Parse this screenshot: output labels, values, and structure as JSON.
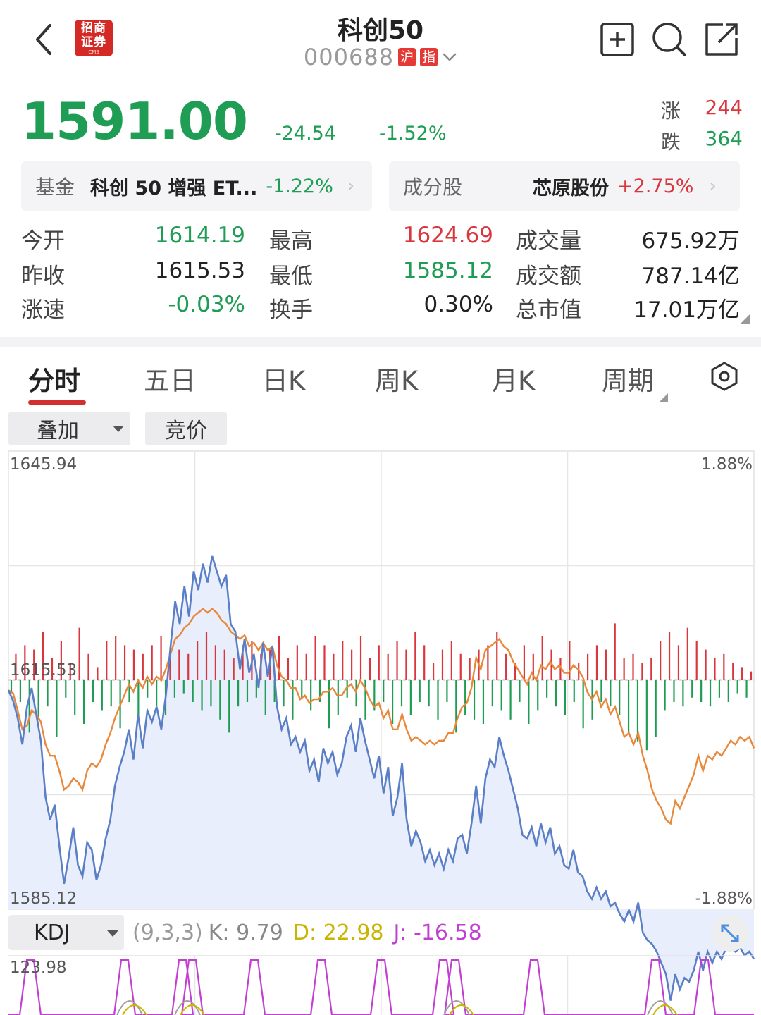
{
  "header": {
    "title": "科创50",
    "code": "000688",
    "tag_market": "沪",
    "tag_type": "指",
    "logo_line1": "招商",
    "logo_line2": "证券",
    "logo_line3": "CMS"
  },
  "quote": {
    "price": "1591.00",
    "change": "-24.54",
    "change_pct": "-1.52%",
    "up_label": "涨",
    "up_count": "244",
    "down_label": "跌",
    "down_count": "364"
  },
  "fund_card": {
    "label": "基金",
    "name": "科创 50 增强 ET...",
    "change": "-1.22%"
  },
  "component_card": {
    "label": "成分股",
    "name": "芯原股份",
    "change": "+2.75%"
  },
  "stats": {
    "rows": [
      [
        {
          "label": "今开",
          "value": "1614.19"
        },
        {
          "label": "最高",
          "value": "1624.69"
        },
        {
          "label": "成交量",
          "value": "675.92万"
        }
      ],
      [
        {
          "label": "昨收",
          "value": "1615.53"
        },
        {
          "label": "最低",
          "value": "1585.12"
        },
        {
          "label": "成交额",
          "value": "787.14亿"
        }
      ],
      [
        {
          "label": "涨速",
          "value": "-0.03%"
        },
        {
          "label": "换手",
          "value": "0.30%"
        },
        {
          "label": "总市值",
          "value": "17.01万亿"
        }
      ]
    ]
  },
  "tabs": [
    "分时",
    "五日",
    "日K",
    "周K",
    "月K",
    "周期"
  ],
  "toolbar": {
    "overlay_label": "叠加",
    "auction_label": "竞价"
  },
  "indicator": {
    "name": "KDJ",
    "params": "(9,3,3)",
    "k_text": "K: 9.79",
    "d_text": "D: 22.98",
    "j_text": "J: -16.58",
    "axis_top": "123.98"
  },
  "colors": {
    "up": "#d9363e",
    "down": "#1f9d55",
    "price_line": "#5b7fc6",
    "avg_line": "#e8883a",
    "fill": "#e8eefb",
    "k_color": "#a0a0a0",
    "d_color": "#c9b400",
    "j_color": "#c23fd2"
  },
  "chart_data": {
    "type": "line",
    "y_labels": {
      "top": "1645.94",
      "mid": "1615.53",
      "bottom": "1585.12",
      "pct_top": "1.88%",
      "pct_bottom": "-1.88%"
    },
    "ylim": [
      1585.12,
      1645.94
    ],
    "baseline": 1615.53,
    "series": [
      {
        "values": [
          1614.2,
          1612.8,
          1610.5,
          1607.0,
          1612.0,
          1614.5,
          1611.0,
          1607.5,
          1600.0,
          1597.0,
          1599.0,
          1593.5,
          1588.5,
          1592.0,
          1596.0,
          1591.0,
          1589.5,
          1594.0,
          1593.0,
          1589.0,
          1591.0,
          1594.5,
          1597.0,
          1601.5,
          1604.0,
          1606.0,
          1609.0,
          1605.0,
          1611.0,
          1606.5,
          1611.5,
          1610.0,
          1612.0,
          1609.0,
          1613.5,
          1620.0,
          1626.0,
          1623.0,
          1628.0,
          1624.0,
          1630.0,
          1627.5,
          1631.0,
          1628.5,
          1632.0,
          1630.0,
          1628.0,
          1629.5,
          1623.0,
          1622.0,
          1617.0,
          1621.0,
          1616.5,
          1619.0,
          1614.5,
          1620.5,
          1616.0,
          1620.0,
          1612.0,
          1609.0,
          1610.5,
          1607.0,
          1608.0,
          1606.0,
          1607.5,
          1603.5,
          1605.0,
          1602.0,
          1606.5,
          1604.5,
          1606.0,
          1603.0,
          1604.5,
          1608.0,
          1609.5,
          1606.0,
          1610.5,
          1607.5,
          1605.0,
          1602.5,
          1605.5,
          1600.5,
          1604.0,
          1597.5,
          1600.0,
          1604.5,
          1597.0,
          1593.5,
          1595.5,
          1594.0,
          1591.5,
          1593.0,
          1591.0,
          1592.5,
          1590.5,
          1593.0,
          1591.5,
          1594.5,
          1595.0,
          1592.5,
          1596.5,
          1601.5,
          1596.5,
          1602.5,
          1605.0,
          1604.0,
          1608.0,
          1605.5,
          1603.5,
          1601.0,
          1598.5,
          1595.0,
          1594.5,
          1596.0,
          1593.5,
          1596.5,
          1594.0,
          1596.0,
          1592.5,
          1593.5,
          1591.0,
          1590.5,
          1593.0,
          1590.0,
          1589.5,
          1587.5,
          1586.5,
          1588.0,
          1586.5,
          1587.5,
          1585.5,
          1586.0,
          1584.5,
          1583.5,
          1585.0,
          1583.5,
          1586.0,
          1582.0,
          1581.0,
          1580.5,
          1579.5,
          1578.0,
          1576.5,
          1573.0,
          1576.5,
          1574.5,
          1576.0,
          1575.5,
          1577.0,
          1579.5,
          1577.0,
          1579.5,
          1578.0,
          1579.5,
          1578.5,
          1580.0,
          1580.5,
          1579.5,
          1580.0,
          1579.0,
          1579.5,
          1578.5
        ]
      },
      {
        "values": [
          1614.2,
          1613.8,
          1611.5,
          1609.0,
          1609.5,
          1611.5,
          1611.0,
          1610.0,
          1607.0,
          1605.5,
          1605.5,
          1603.5,
          1601.0,
          1601.5,
          1602.5,
          1602.0,
          1601.0,
          1603.5,
          1604.5,
          1604.0,
          1605.0,
          1607.0,
          1608.5,
          1610.5,
          1612.0,
          1613.5,
          1615.0,
          1614.0,
          1615.5,
          1614.5,
          1616.0,
          1615.0,
          1616.0,
          1615.5,
          1617.0,
          1619.0,
          1621.0,
          1621.5,
          1622.5,
          1623.0,
          1624.0,
          1624.5,
          1625.0,
          1624.5,
          1625.0,
          1624.5,
          1623.5,
          1623.0,
          1622.0,
          1621.5,
          1621.0,
          1621.5,
          1620.0,
          1620.5,
          1619.5,
          1620.5,
          1619.5,
          1620.0,
          1617.5,
          1616.0,
          1615.5,
          1614.5,
          1614.5,
          1613.0,
          1613.5,
          1612.5,
          1613.0,
          1613.0,
          1614.0,
          1614.0,
          1614.5,
          1613.5,
          1613.5,
          1614.5,
          1615.0,
          1614.0,
          1615.5,
          1614.5,
          1613.0,
          1612.0,
          1612.5,
          1610.5,
          1611.5,
          1609.0,
          1609.0,
          1611.0,
          1609.0,
          1607.5,
          1608.0,
          1607.5,
          1607.0,
          1607.5,
          1607.0,
          1607.5,
          1607.5,
          1608.5,
          1608.5,
          1610.5,
          1612.0,
          1612.5,
          1614.5,
          1618.5,
          1617.0,
          1619.5,
          1620.0,
          1620.5,
          1621.0,
          1620.0,
          1619.5,
          1618.0,
          1617.0,
          1616.0,
          1615.0,
          1616.5,
          1615.5,
          1617.5,
          1617.0,
          1618.0,
          1617.0,
          1617.5,
          1616.5,
          1616.5,
          1617.5,
          1617.0,
          1616.0,
          1614.0,
          1613.0,
          1614.0,
          1612.0,
          1613.0,
          1611.0,
          1612.0,
          1610.0,
          1608.0,
          1608.5,
          1607.0,
          1608.5,
          1605.5,
          1603.5,
          1601.0,
          1599.5,
          1598.5,
          1597.0,
          1596.5,
          1599.5,
          1598.5,
          1600.0,
          1601.5,
          1603.0,
          1605.5,
          1603.5,
          1605.5,
          1605.0,
          1606.0,
          1605.5,
          1606.5,
          1607.5,
          1607.0,
          1608.0,
          1607.5,
          1608.0,
          1606.5
        ]
      }
    ],
    "volume_bars": [
      -0.3,
      0.6,
      -0.5,
      0.8,
      -1.2,
      0.7,
      -0.9,
      1.1,
      -0.6,
      0.5,
      -1.3,
      0.9,
      -0.4,
      0.4,
      -0.8,
      1.2,
      -1.0,
      0.6,
      -0.5,
      0.3,
      -0.7,
      0.9,
      -0.6,
      1.0,
      -1.1,
      0.8,
      -0.5,
      0.7,
      -0.9,
      0.6,
      -0.4,
      0.8,
      -0.6,
      1.0,
      -0.8,
      0.5,
      -0.4,
      0.7,
      -0.3,
      0.6,
      -0.5,
      0.9,
      -0.7,
      1.1,
      -0.6,
      0.8,
      -0.9,
      0.7,
      -1.2,
      0.5,
      -0.6,
      0.8,
      -0.5,
      0.9,
      -0.4,
      0.6,
      -0.8,
      0.7,
      -0.5,
      1.0,
      -0.6,
      0.5,
      -0.9,
      0.8,
      -0.4,
      0.6,
      -0.7,
      1.0,
      -0.5,
      0.8,
      -1.1,
      0.6,
      -0.8,
      0.9,
      -0.4,
      0.7,
      -0.6,
      1.0,
      -0.9,
      0.5,
      -0.7,
      0.8,
      -0.5,
      0.6,
      -1.0,
      0.9,
      -0.6,
      0.7,
      -0.8,
      1.1,
      -0.5,
      0.8,
      -0.6,
      0.4,
      -0.9,
      0.7,
      -0.5,
      0.9,
      -1.2,
      0.6,
      -0.8,
      0.5,
      -0.9,
      0.7,
      -1.0,
      0.8,
      -0.6,
      1.1,
      -0.7,
      0.6,
      -0.9,
      0.4,
      -0.5,
      0.8,
      -1.0,
      0.6,
      -0.7,
      1.0,
      -0.4,
      0.7,
      -0.6,
      0.5,
      -0.8,
      0.9,
      -0.5,
      0.4,
      -1.1,
      0.6,
      -0.9,
      0.8,
      -0.5,
      0.7,
      -0.6,
      1.3,
      -0.8,
      0.5,
      -1.2,
      0.6,
      -1.4,
      0.4,
      -1.6,
      0.5,
      -1.3,
      0.9,
      -0.7,
      1.1,
      -0.5,
      0.8,
      -0.6,
      1.2,
      -0.4,
      0.9,
      -0.5,
      0.7,
      -0.6,
      0.5,
      -0.4,
      0.6,
      -0.5,
      0.4,
      -0.3,
      0.3,
      -0.4,
      0.2
    ]
  }
}
